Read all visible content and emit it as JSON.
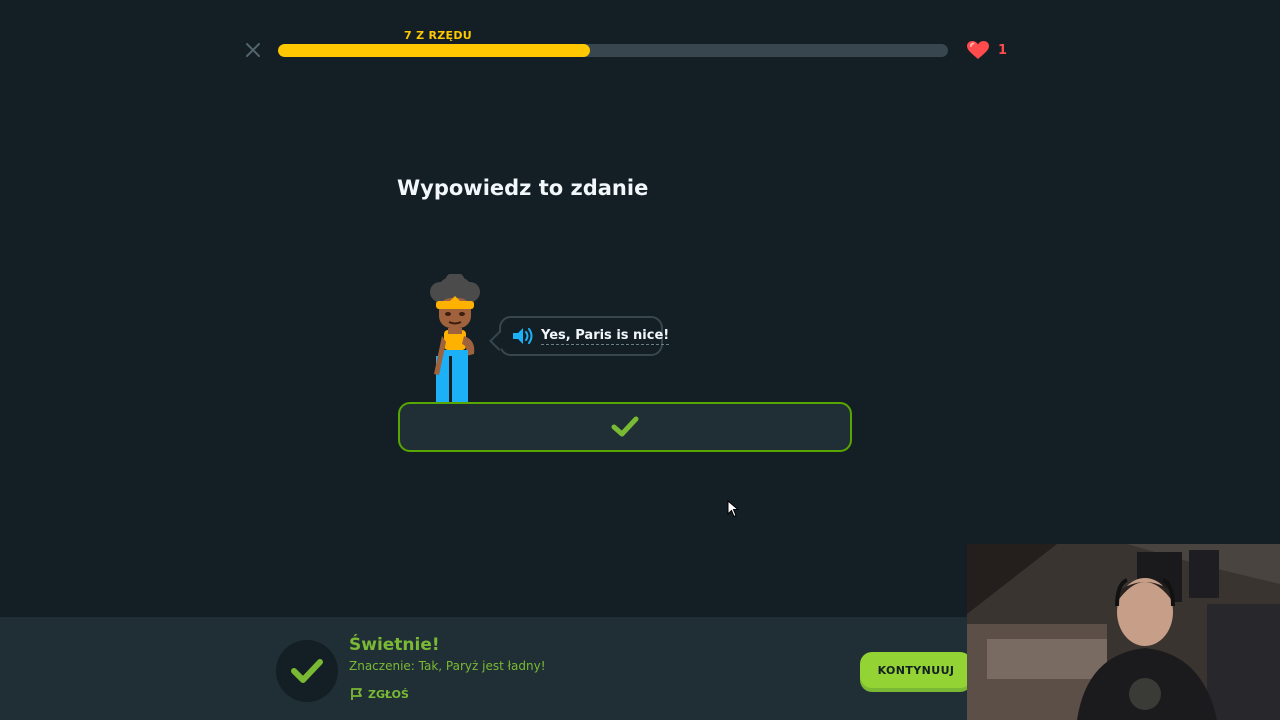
{
  "header": {
    "close_icon": "close-icon",
    "streak_label": "7 Z RZĘDU",
    "progress": 0.466,
    "progress_color": "#ffc800",
    "hearts_icon": "heart-icon",
    "hearts_count": "1"
  },
  "challenge": {
    "prompt": "Wypowiedz to zdanie",
    "sentence": "Yes, Paris is nice!",
    "speaker_icon": "speaker-icon",
    "answer_icon": "checkmark-icon"
  },
  "feedback": {
    "title": "Świetnie!",
    "meaning": "Znaczenie: Tak, Paryż jest ładny!",
    "report_label": "ZGŁOŚ",
    "continue_label": "KONTYNUUJ",
    "accent": "#79b933",
    "button_color": "#93d333"
  }
}
